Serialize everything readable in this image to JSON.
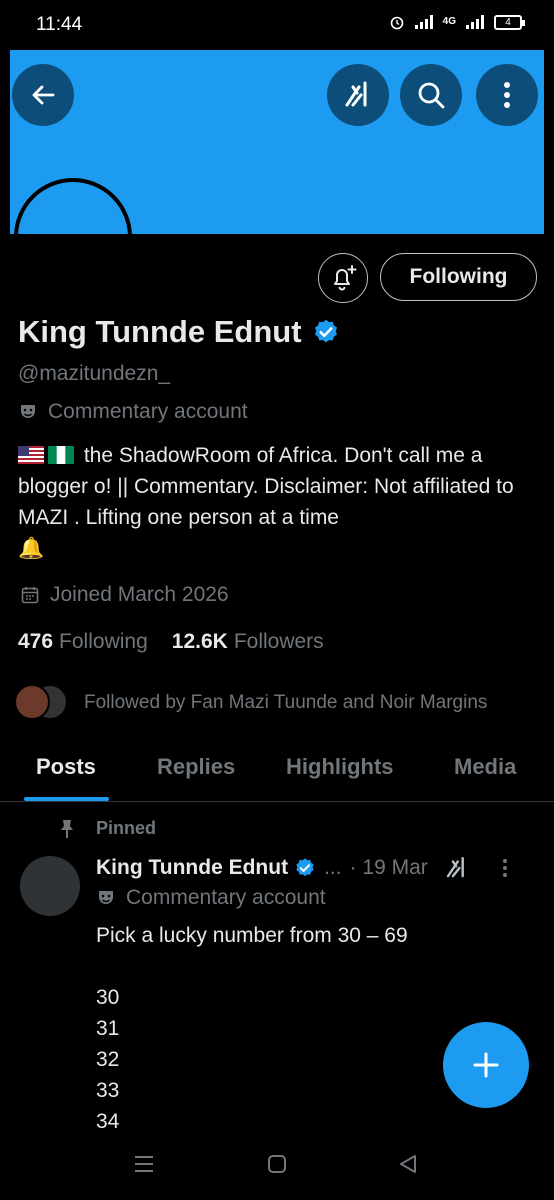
{
  "status": {
    "time": "11:44",
    "network": "4G",
    "battery": "4"
  },
  "profile": {
    "display_name": "King Tunnde Ednut",
    "handle": "@mazitundezn_",
    "category": "Commentary account",
    "bio_text": "the ShadowRoom of Africa. Don't call me a blogger o! || Commentary. Disclaimer: Not affiliated to MAZI . Lifting one person at a time",
    "bio_emoji_end": "🔔",
    "joined": "Joined March 2026",
    "following_count": "476",
    "following_label": "Following",
    "followers_count": "12.6K",
    "followers_label": "Followers",
    "followed_by": "Followed by Fan Mazi Tuunde and Noir Margins"
  },
  "actions": {
    "following_button": "Following"
  },
  "tabs": [
    {
      "label": "Posts"
    },
    {
      "label": "Replies"
    },
    {
      "label": "Highlights"
    },
    {
      "label": "Media"
    }
  ],
  "post": {
    "pinned_label": "Pinned",
    "author": "King Tunnde Ednut",
    "ellipsis": "...",
    "date": "· 19 Mar",
    "category": "Commentary account",
    "body": "Pick a lucky number from 30 – 69\n\n30\n31\n32\n33\n34"
  },
  "colors": {
    "accent": "#1d9bf0",
    "muted": "#71767b",
    "text": "#e7e9ea",
    "background": "#000000"
  },
  "icons": [
    "back-arrow-icon",
    "grok-icon",
    "search-icon",
    "more-vertical-icon",
    "bell-plus-icon",
    "verified-badge-icon",
    "theater-mask-icon",
    "calendar-icon",
    "pin-icon",
    "compose-plus-icon"
  ]
}
